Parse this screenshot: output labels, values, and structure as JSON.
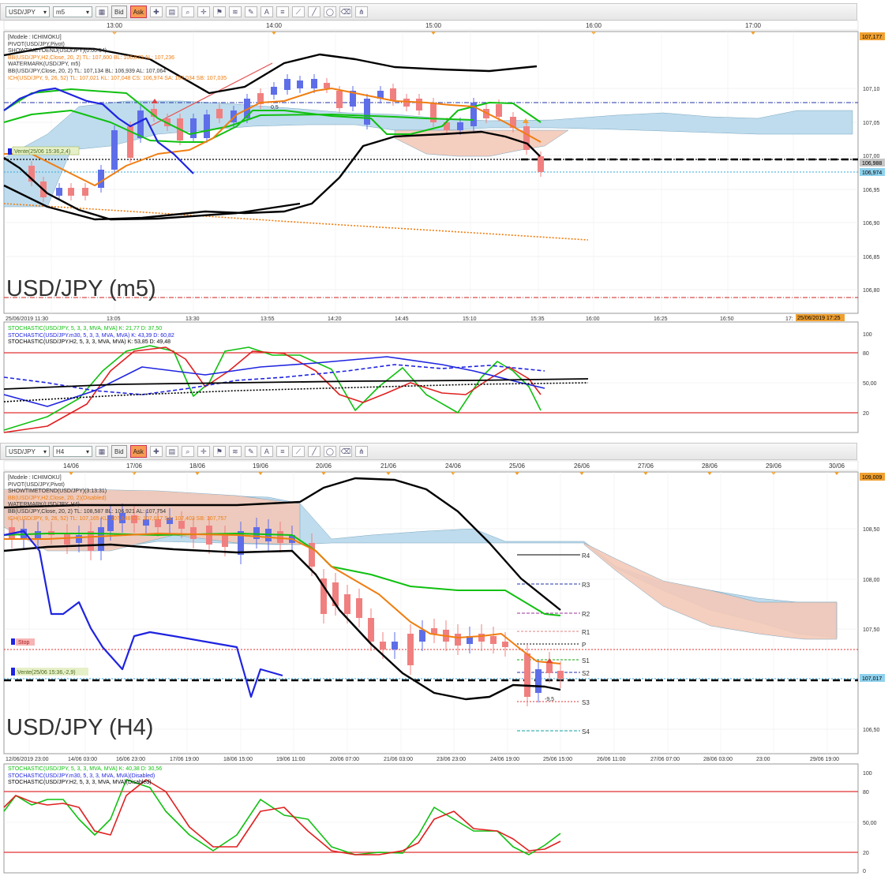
{
  "colors": {
    "green": "#10c010",
    "blue": "#1f24e0",
    "orange": "#f07d10",
    "black": "#000000",
    "cloud_bull": "#b8d9ec",
    "cloud_bear": "#f3c9b8",
    "red_line": "#e03030",
    "bull_candle": "#5e6ee8",
    "bear_candle": "#f08080"
  },
  "top": {
    "toolbar": {
      "symbol": "USD/JPY",
      "period": "m5",
      "bid": "Bid",
      "ask": "Ask"
    },
    "time_top": [
      "13:00",
      "14:00",
      "15:00",
      "16:00",
      "17:00"
    ],
    "legend": [
      "[Modele : ICHIMOKU]",
      "PIVOT(USD/JPY,Pivot)",
      "SHOWTIMETOEND(USD/JPY)(0:00:54)",
      "BB(USD/JPY,H2,Close, 20, 2)   TL: 107,600   BL: 106,873   AL: 107,236",
      "WATERMARK(USD/JPY, m5)",
      "BB(USD/JPY,Close, 20, 2)   TL: 107,134   BL: 106,939   AL: 107,064",
      "ICH(USD/JPY, 9, 26, 52)   TL: 107,021   KL: 107,048   CS: 106,974   SA: 107,034   SB: 107,035"
    ],
    "watermark": "USD/JPY (m5)",
    "sell_tag": "Vente(25/06 15:36,2,4)",
    "price_axis": [
      "107,10",
      "107,05",
      "107,00",
      "106,95",
      "106,90",
      "106,85",
      "106,80"
    ],
    "price_tags": [
      "107,177",
      "106,988",
      "106,974"
    ],
    "time_axis": [
      "25/06/2019 11:30",
      "13:05",
      "13:30",
      "13:55",
      "14:20",
      "14:45",
      "15:10",
      "15:35",
      "16:00",
      "16:25",
      "16:50",
      "17:"
    ],
    "time_tag": "25/06/2019 17:25",
    "annot": "0,5",
    "stoch_legend": [
      "STOCHASTIC(USD/JPY, 5, 3, 3, MVA, MVA)   K: 21,77   D: 37,50",
      "STOCHASTIC(USD/JPY.m30, 5, 3, 3, MVA, MVA)   K: 43,39   D: 60,82",
      "STOCHASTIC(USD/JPY.H2, 5, 3, 3, MVA, MVA)   K: 53,85   D: 49,48"
    ],
    "stoch_axis": [
      "100",
      "80",
      "50,00",
      "20"
    ]
  },
  "bottom": {
    "toolbar": {
      "symbol": "USD/JPY",
      "period": "H4",
      "bid": "Bid",
      "ask": "Ask"
    },
    "time_top": [
      "14/06",
      "17/06",
      "18/06",
      "19/06",
      "20/06",
      "21/06",
      "24/06",
      "25/06",
      "26/06",
      "27/06",
      "28/06",
      "29/06",
      "30/06"
    ],
    "legend": [
      "[Modele : ICHIMOKU]",
      "PIVOT(USD/JPY,Pivot)",
      "SHOWTIMETOEND(USD/JPY)(3:13:31)",
      "BB(USD/JPY,H2,Close, 20, 2)(Disabled)",
      "WATERMARK(USD/JPY, H4)",
      "BB(USD/JPY,Close, 20, 2)   TL: 108,587   BL: 106,921   AL: 107,754",
      "ICH(USD/JPY, 9, 26, 52)   TL: 107,165   KL: 107,648   CS: 107,017   SA: 107,403   SB: 107,757"
    ],
    "watermark": "USD/JPY (H4)",
    "stop_tag": "Stop",
    "sell_tag": "Vente(25/06 15:36,-2,9)",
    "pivots": [
      "R4",
      "R3",
      "R2",
      "R1",
      "P",
      "S1",
      "S2",
      "S3",
      "S4"
    ],
    "price_axis": [
      "108,50",
      "108,00",
      "107,50",
      "107,00",
      "106,50"
    ],
    "price_tags": [
      "109,009",
      "107,017"
    ],
    "time_axis": [
      "12/06/2019 23:00",
      "14/06 03:00",
      "16/06 23:00",
      "17/06 19:00",
      "18/06 15:00",
      "19/06 11:00",
      "20/06 07:00",
      "21/06 03:00",
      "23/06 23:00",
      "24/06 19:00",
      "25/06 15:00",
      "26/06 11:00",
      "27/06 07:00",
      "28/06 03:00",
      "23:00",
      "29/06 19:00"
    ],
    "annot": "-9,5",
    "stoch_legend": [
      "STOCHASTIC(USD/JPY, 5, 3, 3, MVA, MVA)   K: 40,38   D: 30,56",
      "STOCHASTIC(USD/JPY.m30, 5, 3, 3, MVA, MVA)(Disabled)",
      "STOCHASTIC(USD/JPY.H2, 5, 3, 3, MVA, MVA)(Disabled)"
    ],
    "stoch_axis": [
      "100",
      "80",
      "50,00",
      "20",
      "0"
    ]
  }
}
